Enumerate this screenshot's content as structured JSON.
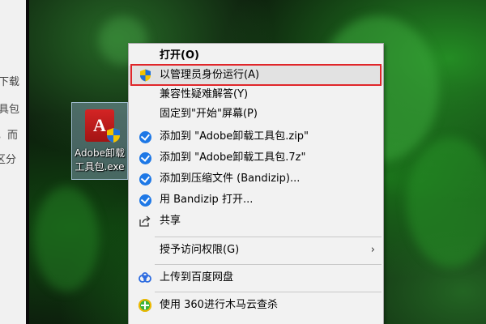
{
  "article": {
    "fragments": [
      "下载",
      "具包",
      "，而",
      "区分"
    ]
  },
  "desktop_icon": {
    "name": "Adobe卸载\n工具包.exe",
    "glyph": "A"
  },
  "context_menu": {
    "items": [
      {
        "label": "打开(O)",
        "icon": "none",
        "bold": true
      },
      {
        "label": "以管理员身份运行(A)",
        "icon": "uac-shield-icon",
        "highlighted": true
      },
      {
        "label": "兼容性疑难解答(Y)",
        "icon": "none"
      },
      {
        "label": "固定到\"开始\"屏幕(P)",
        "icon": "none"
      },
      {
        "label": "添加到 \"Adobe卸载工具包.zip\"",
        "icon": "bandizip-icon"
      },
      {
        "label": "添加到 \"Adobe卸载工具包.7z\"",
        "icon": "bandizip-icon"
      },
      {
        "label": "添加到压缩文件 (Bandizip)...",
        "icon": "bandizip-icon"
      },
      {
        "label": "用 Bandizip 打开...",
        "icon": "bandizip-icon"
      },
      {
        "label": "共享",
        "icon": "share-icon"
      },
      {
        "label": "授予访问权限(G)",
        "icon": "none",
        "submenu": true
      },
      {
        "label": "上传到百度网盘",
        "icon": "baidu-cloud-icon"
      },
      {
        "label": "使用 360进行木马云查杀",
        "icon": "360-icon"
      }
    ],
    "submenu_arrow": "›"
  },
  "colors": {
    "highlight_border": "#e0262a",
    "menu_bg": "#f2f2f2",
    "bandizip_blue": "#1e78e6",
    "adobe_red": "#c41e1e"
  }
}
